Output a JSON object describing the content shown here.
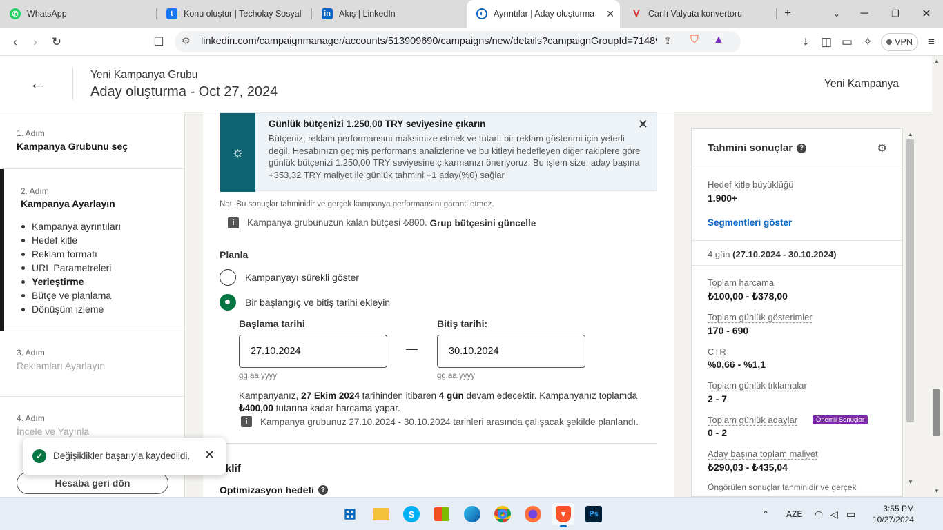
{
  "browser": {
    "tabs": [
      {
        "title": "WhatsApp",
        "icon": "whatsapp-icon",
        "color": "#25d366"
      },
      {
        "title": "Konu oluştur | Techolay Sosyal",
        "icon": "techolay-icon",
        "color": "#1877f2"
      },
      {
        "title": "Akış | LinkedIn",
        "icon": "linkedin-icon",
        "color": "#0a66c2"
      },
      {
        "title": "Ayrıntılar | Aday oluşturma -",
        "icon": "campaign-manager-icon",
        "color": "#0a66c2"
      },
      {
        "title": "Canlı Valyuta konvertoru",
        "icon": "valyuta-icon",
        "color": "#d32f2f"
      }
    ],
    "url": "linkedin.com/campaignmanager/accounts/513909690/campaigns/new/details?campaignGroupId=71489...",
    "vpn_label": "VPN"
  },
  "header": {
    "subtitle": "Yeni Kampanya Grubu",
    "title": "Aday oluşturma - Oct 27, 2024",
    "right_label": "Yeni Kampanya"
  },
  "sidebar": {
    "steps": [
      {
        "number": "1. Adım",
        "name": "Kampanya Grubunu seç"
      },
      {
        "number": "2. Adım",
        "name": "Kampanya Ayarlayın"
      },
      {
        "number": "3. Adım",
        "name": "Reklamları Ayarlayın"
      },
      {
        "number": "4. Adım",
        "name": "İncele ve Yayınla"
      }
    ],
    "substeps": [
      "Kampanya ayrıntıları",
      "Hedef kitle",
      "Reklam formatı",
      "URL Parametreleri",
      "Yerleştirme",
      "Bütçe ve planlama",
      "Dönüşüm izleme"
    ],
    "back_button": "Hesaba geri dön"
  },
  "main": {
    "tip": {
      "title": "Günlük bütçenizi 1.250,00 TRY seviyesine çıkarın",
      "body": "Bütçeniz, reklam performansını maksimize etmek ve tutarlı bir reklam gösterimi için yeterli değil. Hesabınızn geçmiş performans analizlerine ve bu kitleyi hedefleyen diğer rakiplere göre günlük bütçenizi 1.250,00 TRY seviyesine çıkarmanızı öneriyoruz. Bu işlem size, aday başına +353,32 TRY maliyet ile günlük tahmini +1 aday(%0) sağlar"
    },
    "note": "Not: Bu sonuçlar tahminidir ve gerçek kampanya performansını garanti etmez.",
    "budget_info": "Kampanya grubunuzun kalan bütçesi ₺800.",
    "budget_link": "Grup bütçesini güncelle",
    "schedule_label": "Planla",
    "radio_continuous": "Kampanyayı sürekli göster",
    "radio_dates": "Bir başlangıç ve bitiş tarihi ekleyin",
    "start_label": "Başlama tarihi",
    "end_label": "Bitiş tarihi:",
    "start_value": "27.10.2024",
    "end_value": "30.10.2024",
    "date_hint": "gg.aa.yyyy",
    "duration_p1": "Kampanyanız, ",
    "duration_date": "27 Ekim 2024",
    "duration_p2": " tarihinden itibaren ",
    "duration_days": "4 gün",
    "duration_p3": " devam edecektir. Kampanyanız toplamda ",
    "duration_amount": "₺400,00",
    "duration_p4": " tutarına kadar harcama yapar.",
    "group_schedule_info": "Kampanya grubunuz 27.10.2024 - 30.10.2024 tarihleri arasında çalışacak şekilde planlandı.",
    "bid_section": "eklif",
    "opt_goal": "Optimizasyon hedefi"
  },
  "results": {
    "title": "Tahmini sonuçlar",
    "audience_label": "Hedef kitle büyüklüğü",
    "audience_value": "1.900+",
    "segments_link": "Segmentleri göster",
    "days_prefix": "4 gün",
    "days_range": "(27.10.2024 - 30.10.2024)",
    "metrics": [
      {
        "label": "Toplam harcama",
        "value": "₺100,00 - ₺378,00"
      },
      {
        "label": "Toplam günlük gösterimler",
        "value": "170 - 690"
      },
      {
        "label": "CTR",
        "value": "%0,66 - %1,1"
      },
      {
        "label": "Toplam günlük tıklamalar",
        "value": "2 - 7"
      },
      {
        "label": "Toplam günlük adaylar",
        "value": "0 - 2"
      },
      {
        "label": "Aday başına toplam maliyet",
        "value": "₺290,03 - ₺435,04"
      }
    ],
    "badge": "Önemli Sonuçlar",
    "footer": "Öngörülen sonuçlar tahminidir ve gerçek"
  },
  "toast": {
    "message": "Değişiklikler başarıyla kaydedildi."
  },
  "taskbar": {
    "language": "AZE",
    "time": "3:55 PM",
    "date": "10/27/2024"
  },
  "colors": {
    "linkedin_blue": "#0a66c2",
    "success_green": "#057642",
    "tip_teal": "#0e6471",
    "badge_purple": "#7a2aa8"
  }
}
